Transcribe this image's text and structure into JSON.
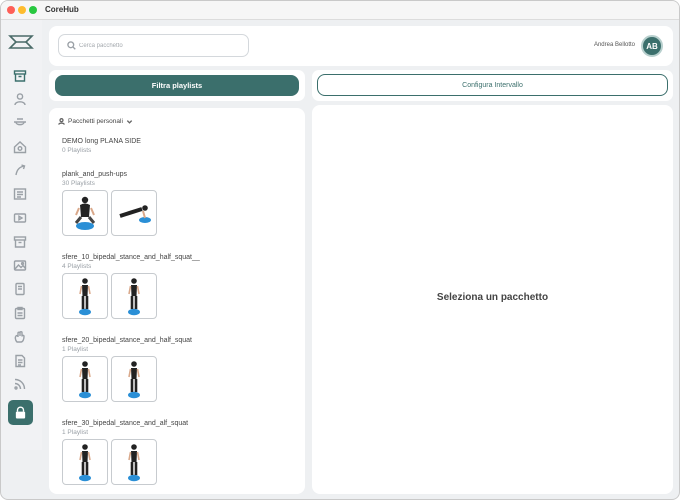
{
  "window": {
    "title": "CoreHub"
  },
  "sidebar": {
    "items": [
      {
        "icon": "archive-icon",
        "active": true
      },
      {
        "icon": "user-icon"
      },
      {
        "icon": "hat-icon"
      },
      {
        "icon": "settings-house-icon"
      },
      {
        "icon": "pointer-icon"
      },
      {
        "icon": "list-icon"
      },
      {
        "icon": "video-icon"
      },
      {
        "icon": "box-icon"
      },
      {
        "icon": "gallery-icon"
      },
      {
        "icon": "book-icon"
      },
      {
        "icon": "clipboard-icon"
      },
      {
        "icon": "hand-icon"
      },
      {
        "icon": "document-icon"
      },
      {
        "icon": "rss-icon"
      }
    ],
    "lock_icon": "lock-icon"
  },
  "header": {
    "search_placeholder": "Cerca pacchetto",
    "user_name": "Andrea Bellotto",
    "avatar_initials": "AB"
  },
  "toolbar": {
    "filter_label": "Filtra playlists",
    "config_label": "Configura Intervallo"
  },
  "list": {
    "filter_label": "Pacchetti personali",
    "packages": [
      {
        "name": "DEMO long  PLANA SIDE",
        "count": "0 Playlists",
        "thumbs": []
      },
      {
        "name": "plank_and_push-ups",
        "count": "30 Playlists",
        "thumbs": [
          "seated",
          "plank"
        ]
      },
      {
        "name": "sfere_10_bipedal_stance_and_half_squat__",
        "count": "4 Playlists",
        "thumbs": [
          "stand",
          "stand"
        ]
      },
      {
        "name": "sfere_20_bipedal_stance_and_half_squat",
        "count": "1 Playlist",
        "thumbs": [
          "stand",
          "stand"
        ]
      },
      {
        "name": "sfere_30_bipedal_stance_and_alf_squat",
        "count": "1 Playlist",
        "thumbs": [
          "stand",
          "stand"
        ]
      }
    ]
  },
  "detail": {
    "placeholder": "Seleziona un pacchetto"
  },
  "colors": {
    "accent": "#3b6f6c",
    "ball": "#2a8fd6"
  }
}
